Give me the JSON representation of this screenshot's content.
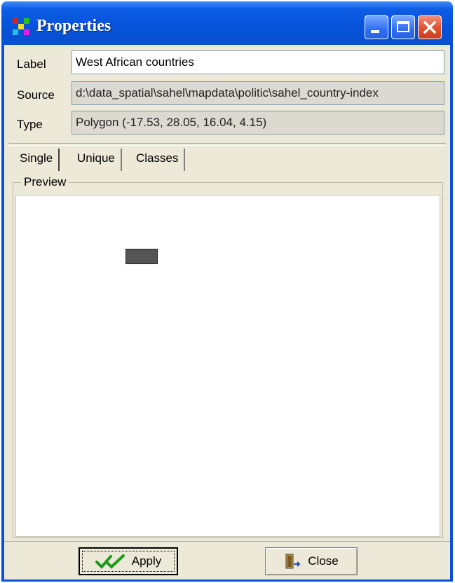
{
  "window": {
    "title": "Properties"
  },
  "fields": {
    "label": {
      "caption": "Label",
      "value": "West African countries"
    },
    "source": {
      "caption": "Source",
      "value": "d:\\data_spatial\\sahel\\mapdata\\politic\\sahel_country-index"
    },
    "type": {
      "caption": "Type",
      "value": "Polygon  (-17.53, 28.05, 16.04, 4.15)"
    }
  },
  "tabs": [
    {
      "label": "Single",
      "active": true
    },
    {
      "label": "Unique",
      "active": false
    },
    {
      "label": "Classes",
      "active": false
    }
  ],
  "preview": {
    "group_title": "Preview",
    "swatch_color": "#555555"
  },
  "buttons": {
    "apply_label": "Apply",
    "close_label": "Close"
  },
  "icons": {
    "app": "layers-icon",
    "apply": "double-checkmark-icon",
    "close": "door-exit-icon"
  },
  "colors": {
    "titlebar": "#0552d8",
    "dialog_bg": "#ece9d8",
    "close_button": "#e0502e"
  }
}
